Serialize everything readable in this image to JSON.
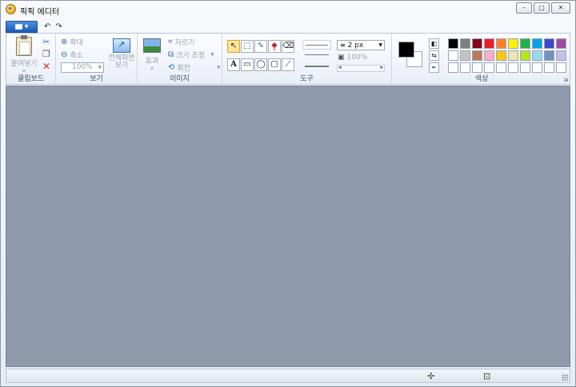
{
  "window": {
    "title": "픽픽 에디터",
    "buttons": {
      "minimize": "–",
      "maximize": "□",
      "close": "✕"
    }
  },
  "quick_access": {
    "undo": "↶",
    "redo": "↷"
  },
  "clipboard": {
    "paste_label": "붙여넣기",
    "group_label": "클립보드"
  },
  "view": {
    "zoom_in": "확대",
    "zoom_out": "축소",
    "zoom_value": "100%",
    "fullscreen_line1": "전체화면",
    "fullscreen_line2": "보기",
    "group_label": "보기"
  },
  "image": {
    "effect": "효과",
    "crop": "자르기",
    "resize": "크기 조정",
    "rotate": "회전",
    "group_label": "이미지"
  },
  "tools": {
    "text_tool": "A",
    "line_size": "2 px",
    "opacity": "100%",
    "group_label": "도구"
  },
  "colors": {
    "group_label": "색상",
    "primary": "#000000",
    "secondary": "#ffffff",
    "palette_row1": [
      "#000000",
      "#7f7f7f",
      "#880015",
      "#ed1c24",
      "#ff7f27",
      "#fff200",
      "#22b14c",
      "#00a2e8",
      "#3f48cc",
      "#a349a4"
    ],
    "palette_row2": [
      "#ffffff",
      "#c3c3c3",
      "#b97a57",
      "#ffaec9",
      "#ffc90e",
      "#efe4b0",
      "#b5e61d",
      "#99d9ea",
      "#7092be",
      "#c8bfe7"
    ],
    "palette_row3": [
      "#ffffff",
      "#ffffff",
      "#ffffff",
      "#ffffff",
      "#ffffff",
      "#ffffff",
      "#ffffff",
      "#ffffff",
      "#ffffff",
      "#ffffff"
    ]
  },
  "status": {
    "move_icon": "✢",
    "size_icon": "⊡"
  }
}
